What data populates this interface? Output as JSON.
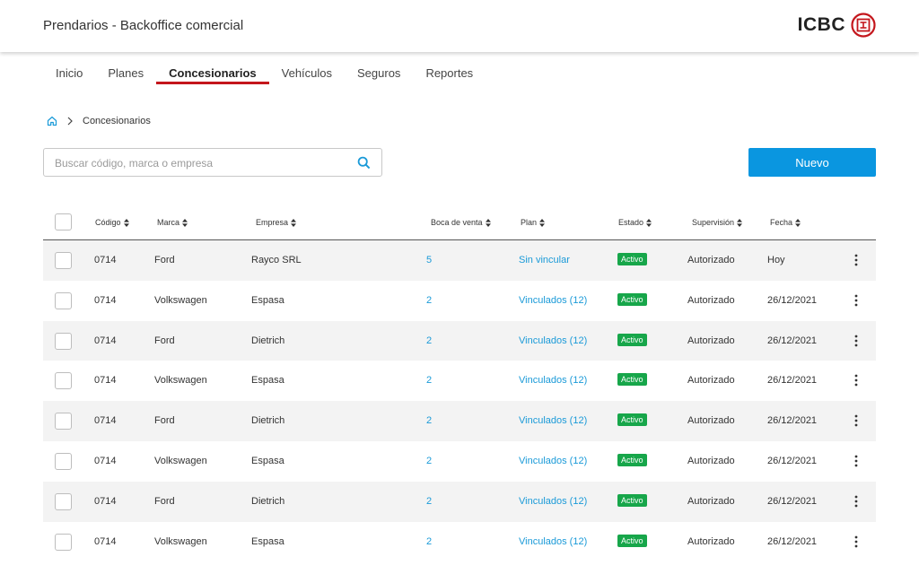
{
  "header": {
    "title": "Prendarios - Backoffice comercial",
    "brand": "ICBC"
  },
  "nav": {
    "tabs": [
      {
        "label": "Inicio"
      },
      {
        "label": "Planes"
      },
      {
        "label": "Concesionarios",
        "active": true
      },
      {
        "label": "Vehículos"
      },
      {
        "label": "Seguros"
      },
      {
        "label": "Reportes"
      }
    ]
  },
  "breadcrumb": {
    "current": "Concesionarios"
  },
  "search": {
    "placeholder": "Buscar código, marca o empresa",
    "value": ""
  },
  "actions": {
    "new_label": "Nuevo"
  },
  "table": {
    "columns": [
      "Código",
      "Marca",
      "Empresa",
      "Boca de venta",
      "Plan",
      "Estado",
      "Supervisión",
      "Fecha"
    ],
    "rows": [
      {
        "codigo": "0714",
        "marca": "Ford",
        "empresa": "Rayco SRL",
        "boca": "5",
        "plan": "Sin vincular",
        "estado": "Activo",
        "supervision": "Autorizado",
        "fecha": "Hoy"
      },
      {
        "codigo": "0714",
        "marca": "Volkswagen",
        "empresa": "Espasa",
        "boca": "2",
        "plan": "Vinculados (12)",
        "estado": "Activo",
        "supervision": "Autorizado",
        "fecha": "26/12/2021"
      },
      {
        "codigo": "0714",
        "marca": "Ford",
        "empresa": "Dietrich",
        "boca": "2",
        "plan": "Vinculados (12)",
        "estado": "Activo",
        "supervision": "Autorizado",
        "fecha": "26/12/2021"
      },
      {
        "codigo": "0714",
        "marca": "Volkswagen",
        "empresa": "Espasa",
        "boca": "2",
        "plan": "Vinculados (12)",
        "estado": "Activo",
        "supervision": "Autorizado",
        "fecha": "26/12/2021"
      },
      {
        "codigo": "0714",
        "marca": "Ford",
        "empresa": "Dietrich",
        "boca": "2",
        "plan": "Vinculados (12)",
        "estado": "Activo",
        "supervision": "Autorizado",
        "fecha": "26/12/2021"
      },
      {
        "codigo": "0714",
        "marca": "Volkswagen",
        "empresa": "Espasa",
        "boca": "2",
        "plan": "Vinculados (12)",
        "estado": "Activo",
        "supervision": "Autorizado",
        "fecha": "26/12/2021"
      },
      {
        "codigo": "0714",
        "marca": "Ford",
        "empresa": "Dietrich",
        "boca": "2",
        "plan": "Vinculados (12)",
        "estado": "Activo",
        "supervision": "Autorizado",
        "fecha": "26/12/2021"
      },
      {
        "codigo": "0714",
        "marca": "Volkswagen",
        "empresa": "Espasa",
        "boca": "2",
        "plan": "Vinculados (12)",
        "estado": "Activo",
        "supervision": "Autorizado",
        "fecha": "26/12/2021"
      }
    ]
  },
  "colors": {
    "accent": "#0a96e0",
    "brand_red": "#c4161c",
    "status_active": "#17a64a",
    "link": "#1a9ad8",
    "row_shade": "#f3f3f3"
  },
  "icons": {
    "home": "home-icon",
    "breadcrumb_separator": "chevron-right-icon",
    "search": "search-icon",
    "sort": "sort-icon",
    "row_menu": "more-vertical-icon",
    "logo": "icbc-logo-icon"
  }
}
